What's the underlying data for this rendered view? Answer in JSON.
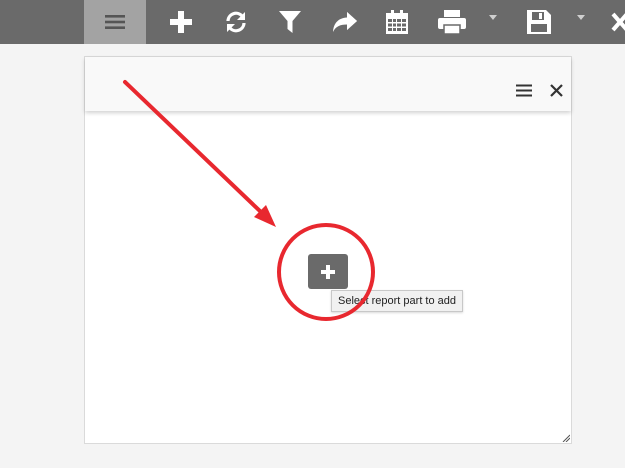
{
  "toolbar": {
    "buttons": [
      {
        "icon": "menu-icon",
        "active": true
      },
      {
        "icon": "plus-icon"
      },
      {
        "icon": "refresh-icon"
      },
      {
        "icon": "filter-icon"
      },
      {
        "icon": "share-arrow-icon"
      },
      {
        "icon": "calendar-icon"
      },
      {
        "icon": "print-icon",
        "has_dropdown": true
      },
      {
        "icon": "save-icon",
        "has_dropdown": true
      },
      {
        "icon": "close-icon"
      }
    ]
  },
  "panel": {
    "header_buttons": [
      {
        "icon": "hamburger-icon"
      },
      {
        "icon": "close-icon"
      }
    ],
    "add_button": {
      "icon": "plus-icon",
      "tooltip": "Select report part to add"
    }
  },
  "annotation": {
    "color": "#e8282f",
    "shapes": [
      "arrow",
      "circle"
    ]
  },
  "colors": {
    "toolbar_bg": "#6a6a6a",
    "toolbar_active": "#a3a3a3",
    "icon": "#ffffff",
    "page_bg": "#f4f4f4"
  }
}
